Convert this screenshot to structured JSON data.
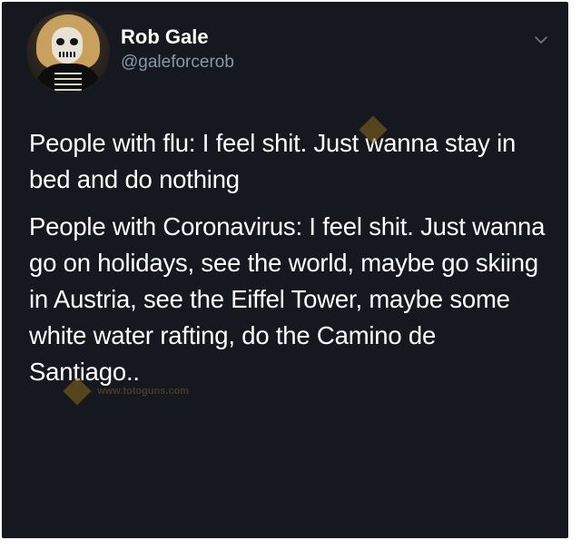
{
  "author": {
    "name": "Rob Gale",
    "handle": "@galeforcerob"
  },
  "tweet": {
    "paragraph_1": "People with flu: I feel shit. Just wanna stay in bed and do nothing",
    "paragraph_2": "People with Coronavirus: I feel shit. Just wanna go on holidays, see the world, maybe go skiing in Austria, see the Eiffel Tower, maybe some white water rafting, do the Camino de Santiago.."
  },
  "watermark": {
    "site": "www.totoguns.com"
  },
  "icons": {
    "menu": "chevron-down-icon",
    "avatar": "profile-photo"
  },
  "colors": {
    "background": "#15181f",
    "text": "#ffffff",
    "handle": "#8899a6"
  }
}
